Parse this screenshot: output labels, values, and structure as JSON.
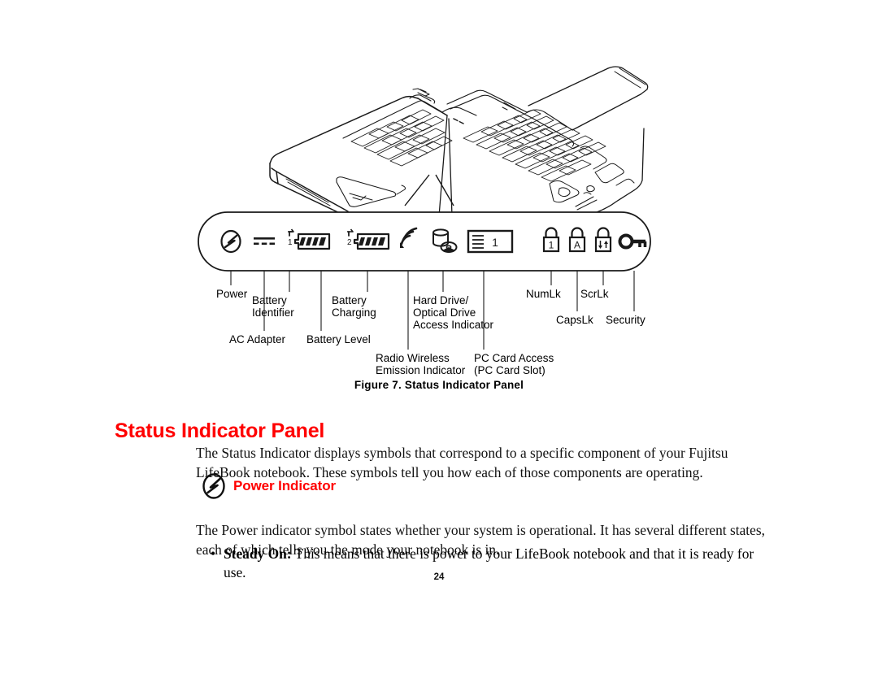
{
  "figure": {
    "caption": "Figure 7.  Status Indicator Panel",
    "illustration_name": "fujitsu-lifebook-notebook-line-art",
    "panel": {
      "icons": [
        {
          "id": "power",
          "name": "power-symbol-icon",
          "glyph": "circle-with-bolt"
        },
        {
          "id": "ac-adapter",
          "name": "ac-adapter-dc-icon",
          "glyph": "solid-line-over-dashed-line"
        },
        {
          "id": "battery-1",
          "name": "battery-1-icon",
          "glyph": "battery-with-arrow",
          "subscript": "1"
        },
        {
          "id": "battery-2",
          "name": "battery-2-icon",
          "glyph": "battery-with-arrow",
          "subscript": "2"
        },
        {
          "id": "radio-wireless",
          "name": "radio-wireless-icon",
          "glyph": "radio-waves"
        },
        {
          "id": "hard-drive",
          "name": "hard-drive-optical-drive-icon",
          "glyph": "cylinder-and-disc"
        },
        {
          "id": "pc-card",
          "name": "pc-card-access-icon",
          "glyph": "card-slot",
          "label": "1"
        },
        {
          "id": "numlk",
          "name": "numlock-padlock-icon",
          "glyph": "padlock",
          "label": "1"
        },
        {
          "id": "capslk",
          "name": "capslock-padlock-icon",
          "glyph": "padlock",
          "label": "A"
        },
        {
          "id": "scrlk",
          "name": "scrolllock-padlock-icon",
          "glyph": "padlock",
          "label": "arrows"
        },
        {
          "id": "security",
          "name": "security-key-icon",
          "glyph": "key"
        }
      ],
      "callouts": [
        {
          "id": "power",
          "label": "Power"
        },
        {
          "id": "ac-adapter",
          "label": "AC Adapter"
        },
        {
          "id": "battery-identifier",
          "label": "Battery\nIdentifier"
        },
        {
          "id": "battery-level",
          "label": "Battery Level"
        },
        {
          "id": "battery-charging",
          "label": "Battery\nCharging"
        },
        {
          "id": "radio-wireless",
          "label": "Radio Wireless\nEmission Indicator"
        },
        {
          "id": "hard-drive",
          "label": "Hard Drive/\nOptical Drive\nAccess Indicator"
        },
        {
          "id": "pc-card",
          "label": "PC Card Access\n(PC Card Slot)"
        },
        {
          "id": "numlk",
          "label": "NumLk"
        },
        {
          "id": "capslk",
          "label": "CapsLk"
        },
        {
          "id": "scrlk",
          "label": "ScrLk"
        },
        {
          "id": "security",
          "label": "Security"
        }
      ]
    }
  },
  "section": {
    "heading": "Status Indicator Panel",
    "intro_paragraph": "The Status Indicator displays symbols that correspond to a specific component of your Fujitsu LifeBook notebook. These symbols tell you how each of those components are operating.",
    "power_indicator": {
      "heading": "Power Indicator",
      "paragraph": "The Power indicator symbol states whether your system is operational. It has several different states, each of which tells you the mode your notebook is in.",
      "bullets": [
        {
          "term": "Steady On:",
          "text": " This means that there is power to your LifeBook notebook and that it is ready for use."
        }
      ]
    }
  },
  "page_number": "24",
  "colors": {
    "heading_red": "#ff0000",
    "text_black": "#111111",
    "line_black": "#1a1a1a"
  }
}
